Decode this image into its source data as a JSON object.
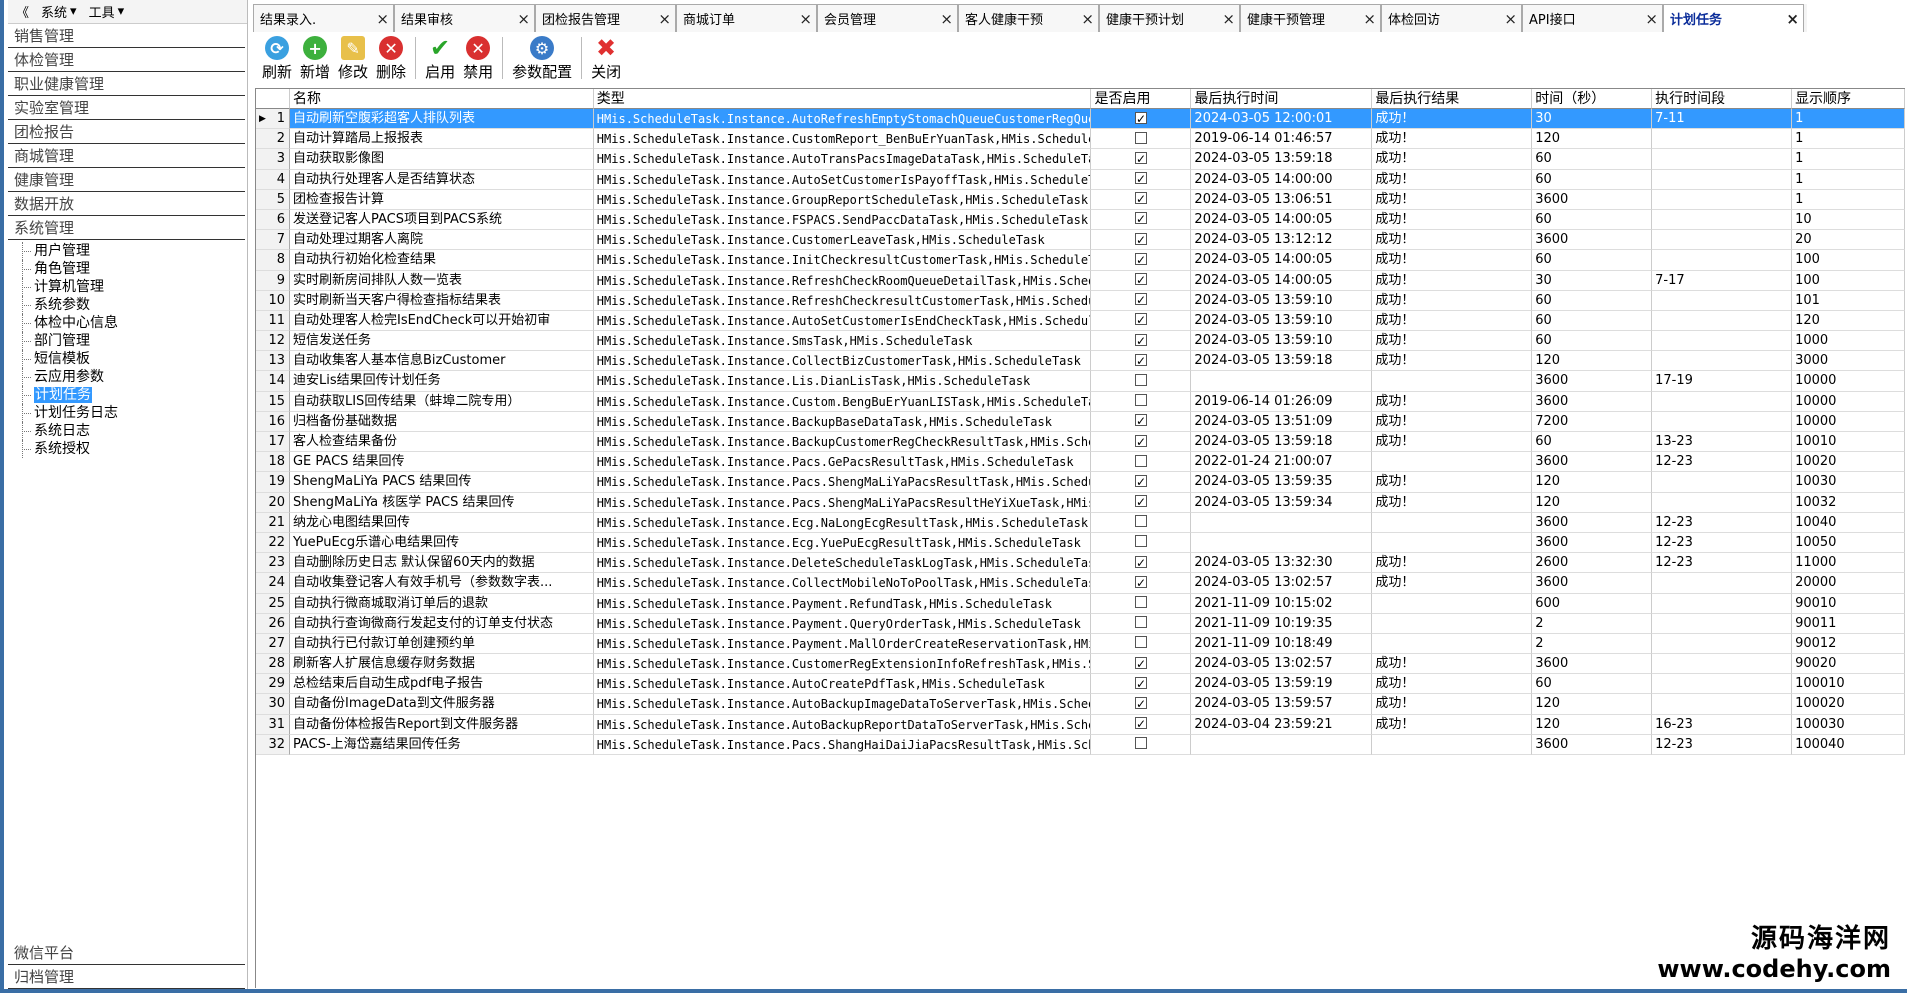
{
  "sidebar": {
    "collapse_glyph": "《",
    "menu_system": "系统",
    "menu_tools": "工具",
    "groups_top": [
      "销售管理",
      "体检管理",
      "职业健康管理",
      "实验室管理",
      "团检报告",
      "商城管理",
      "健康管理",
      "数据开放",
      "系统管理"
    ],
    "tree": [
      "用户管理",
      "角色管理",
      "计算机管理",
      "系统参数",
      "体检中心信息",
      "部门管理",
      "短信模板",
      "云应用参数",
      "计划任务",
      "计划任务日志",
      "系统日志",
      "系统授权"
    ],
    "selected_tree_index": 8,
    "groups_bottom": [
      "微信平台",
      "归档管理"
    ]
  },
  "tabs": [
    {
      "label": "结果录入."
    },
    {
      "label": "结果审核"
    },
    {
      "label": "团检报告管理"
    },
    {
      "label": "商城订单"
    },
    {
      "label": "会员管理"
    },
    {
      "label": "客人健康干预"
    },
    {
      "label": "健康干预计划"
    },
    {
      "label": "健康干预管理"
    },
    {
      "label": "体检回访"
    },
    {
      "label": "API接口"
    },
    {
      "label": "计划任务",
      "active": true
    }
  ],
  "toolbar": {
    "refresh": "刷新",
    "add": "新增",
    "edit": "修改",
    "delete": "删除",
    "enable": "启用",
    "disable": "禁用",
    "param_config": "参数配置",
    "close": "关闭"
  },
  "columns": {
    "name": "名称",
    "type": "类型",
    "enabled": "是否启用",
    "last_run": "最后执行时间",
    "last_result": "最后执行结果",
    "interval": "时间（秒）",
    "period": "执行时间段",
    "order": "显示顺序"
  },
  "rows": [
    {
      "i": "1",
      "name": "自动刷新空腹彩超客人排队列表",
      "type": "HMis.ScheduleTask.Instance.AutoRefreshEmptyStomachQueueCustomerRegQueu",
      "on": true,
      "last": "2024-03-05 12:00:01",
      "result": "成功！",
      "sec": "30",
      "period": "7-11",
      "order": "1"
    },
    {
      "i": "2",
      "name": "自动计算踏局上报报表",
      "type": "HMis.ScheduleTask.Instance.CustomReport_BenBuErYuanTask,HMis.ScheduleT",
      "on": false,
      "last": "2019-06-14 01:46:57",
      "result": "成功！",
      "sec": "120",
      "period": "",
      "order": "1"
    },
    {
      "i": "3",
      "name": "自动获取影像图",
      "type": "HMis.ScheduleTask.Instance.AutoTransPacsImageDataTask,HMis.ScheduleTas",
      "on": true,
      "last": "2024-03-05 13:59:18",
      "result": "成功！",
      "sec": "60",
      "period": "",
      "order": "1"
    },
    {
      "i": "4",
      "name": "自动执行处理客人是否结算状态",
      "type": "HMis.ScheduleTask.Instance.AutoSetCustomerIsPayoffTask,HMis.ScheduleTa",
      "on": true,
      "last": "2024-03-05 14:00:00",
      "result": "成功！",
      "sec": "60",
      "period": "",
      "order": "1"
    },
    {
      "i": "5",
      "name": "团检查报告计算",
      "type": "HMis.ScheduleTask.Instance.GroupReportScheduleTask,HMis.ScheduleTask",
      "on": true,
      "last": "2024-03-05 13:06:51",
      "result": "成功！",
      "sec": "3600",
      "period": "",
      "order": "1"
    },
    {
      "i": "6",
      "name": "发送登记客人PACS项目到PACS系统",
      "type": "HMis.ScheduleTask.Instance.FSPACS.SendPaccDataTask,HMis.ScheduleTask",
      "on": true,
      "last": "2024-03-05 14:00:05",
      "result": "成功！",
      "sec": "60",
      "period": "",
      "order": "10"
    },
    {
      "i": "7",
      "name": "自动处理过期客人离院",
      "type": "HMis.ScheduleTask.Instance.CustomerLeaveTask,HMis.ScheduleTask",
      "on": true,
      "last": "2024-03-05 13:12:12",
      "result": "成功！",
      "sec": "3600",
      "period": "",
      "order": "20"
    },
    {
      "i": "8",
      "name": "自动执行初始化检查结果",
      "type": "HMis.ScheduleTask.Instance.InitCheckresultCustomerTask,HMis.ScheduleTa",
      "on": true,
      "last": "2024-03-05 14:00:05",
      "result": "成功！",
      "sec": "60",
      "period": "",
      "order": "100"
    },
    {
      "i": "9",
      "name": "实时刷新房间排队人数一览表",
      "type": "HMis.ScheduleTask.Instance.RefreshCheckRoomQueueDetailTask,HMis.Schedu",
      "on": true,
      "last": "2024-03-05 14:00:05",
      "result": "成功！",
      "sec": "30",
      "period": "7-17",
      "order": "100"
    },
    {
      "i": "10",
      "name": "实时刷新当天客户得检查指标结果表",
      "type": "HMis.ScheduleTask.Instance.RefreshCheckresultCustomerTask,HMis.Schedul",
      "on": true,
      "last": "2024-03-05 13:59:10",
      "result": "成功！",
      "sec": "60",
      "period": "",
      "order": "101"
    },
    {
      "i": "11",
      "name": "自动处理客人检完IsEndCheck可以开始初审",
      "type": "HMis.ScheduleTask.Instance.AutoSetCustomerIsEndCheckTask,HMis.Schedule",
      "on": true,
      "last": "2024-03-05 13:59:10",
      "result": "成功！",
      "sec": "60",
      "period": "",
      "order": "120"
    },
    {
      "i": "12",
      "name": "短信发送任务",
      "type": "HMis.ScheduleTask.Instance.SmsTask,HMis.ScheduleTask",
      "on": true,
      "last": "2024-03-05 13:59:10",
      "result": "成功！",
      "sec": "60",
      "period": "",
      "order": "1000"
    },
    {
      "i": "13",
      "name": "自动收集客人基本信息BizCustomer",
      "type": "HMis.ScheduleTask.Instance.CollectBizCustomerTask,HMis.ScheduleTask",
      "on": true,
      "last": "2024-03-05 13:59:18",
      "result": "成功！",
      "sec": "120",
      "period": "",
      "order": "3000"
    },
    {
      "i": "14",
      "name": "迪安Lis结果回传计划任务",
      "type": "HMis.ScheduleTask.Instance.Lis.DianLisTask,HMis.ScheduleTask",
      "on": false,
      "last": "",
      "result": "",
      "sec": "3600",
      "period": "17-19",
      "order": "10000"
    },
    {
      "i": "15",
      "name": "自动获取LIS回传结果（蚌埠二院专用）",
      "type": "HMis.ScheduleTask.Instance.Custom.BengBuErYuanLISTask,HMis.ScheduleTas",
      "on": false,
      "last": "2019-06-14 01:26:09",
      "result": "成功！",
      "sec": "3600",
      "period": "",
      "order": "10000"
    },
    {
      "i": "16",
      "name": "归档备份基础数据",
      "type": "HMis.ScheduleTask.Instance.BackupBaseDataTask,HMis.ScheduleTask",
      "on": true,
      "last": "2024-03-05 13:51:09",
      "result": "成功！",
      "sec": "7200",
      "period": "",
      "order": "10000"
    },
    {
      "i": "17",
      "name": "客人检查结果备份",
      "type": "HMis.ScheduleTask.Instance.BackupCustomerRegCheckResultTask,HMis.Sched",
      "on": true,
      "last": "2024-03-05 13:59:18",
      "result": "成功！",
      "sec": "60",
      "period": "13-23",
      "order": "10010"
    },
    {
      "i": "18",
      "name": "GE PACS 结果回传",
      "type": "HMis.ScheduleTask.Instance.Pacs.GePacsResultTask,HMis.ScheduleTask",
      "on": false,
      "last": "2022-01-24 21:00:07",
      "result": "",
      "sec": "3600",
      "period": "12-23",
      "order": "10020"
    },
    {
      "i": "19",
      "name": "ShengMaLiYa PACS 结果回传",
      "type": "HMis.ScheduleTask.Instance.Pacs.ShengMaLiYaPacsResultTask,HMis.Schedul",
      "on": true,
      "last": "2024-03-05 13:59:35",
      "result": "成功！",
      "sec": "120",
      "period": "",
      "order": "10030"
    },
    {
      "i": "20",
      "name": "ShengMaLiYa 核医学 PACS 结果回传",
      "type": "HMis.ScheduleTask.Instance.Pacs.ShengMaLiYaPacsResultHeYiXueTask,HMis.",
      "on": true,
      "last": "2024-03-05 13:59:34",
      "result": "成功！",
      "sec": "120",
      "period": "",
      "order": "10032"
    },
    {
      "i": "21",
      "name": "纳龙心电图结果回传",
      "type": "HMis.ScheduleTask.Instance.Ecg.NaLongEcgResultTask,HMis.ScheduleTask",
      "on": false,
      "last": "",
      "result": "",
      "sec": "3600",
      "period": "12-23",
      "order": "10040"
    },
    {
      "i": "22",
      "name": "YuePuEcg乐谱心电结果回传",
      "type": "HMis.ScheduleTask.Instance.Ecg.YuePuEcgResultTask,HMis.ScheduleTask",
      "on": false,
      "last": "",
      "result": "",
      "sec": "3600",
      "period": "12-23",
      "order": "10050"
    },
    {
      "i": "23",
      "name": "自动删除历史日志 默认保留60天内的数据",
      "type": "HMis.ScheduleTask.Instance.DeleteScheduleTaskLogTask,HMis.ScheduleTask",
      "on": true,
      "last": "2024-03-05 13:32:30",
      "result": "成功！",
      "sec": "2600",
      "period": "12-23",
      "order": "11000"
    },
    {
      "i": "24",
      "name": "自动收集登记客人有效手机号（参数数字表...",
      "type": "HMis.ScheduleTask.Instance.CollectMobileNoToPoolTask,HMis.ScheduleTask",
      "on": true,
      "last": "2024-03-05 13:02:57",
      "result": "成功！",
      "sec": "3600",
      "period": "",
      "order": "20000"
    },
    {
      "i": "25",
      "name": "自动执行微商城取消订单后的退款",
      "type": "HMis.ScheduleTask.Instance.Payment.RefundTask,HMis.ScheduleTask",
      "on": false,
      "last": "2021-11-09 10:15:02",
      "result": "",
      "sec": "600",
      "period": "",
      "order": "90010"
    },
    {
      "i": "26",
      "name": "自动执行查询微商行发起支付的订单支付状态",
      "type": "HMis.ScheduleTask.Instance.Payment.QueryOrderTask,HMis.ScheduleTask",
      "on": false,
      "last": "2021-11-09 10:19:35",
      "result": "",
      "sec": "2",
      "period": "",
      "order": "90011"
    },
    {
      "i": "27",
      "name": "自动执行已付款订单创建预约单",
      "type": "HMis.ScheduleTask.Instance.Payment.MallOrderCreateReservationTask,HMis",
      "on": false,
      "last": "2021-11-09 10:18:49",
      "result": "",
      "sec": "2",
      "period": "",
      "order": "90012"
    },
    {
      "i": "28",
      "name": "刷新客人扩展信息缓存财务数据",
      "type": "HMis.ScheduleTask.Instance.CustomerRegExtensionInfoRefreshTask,HMis.Sc",
      "on": true,
      "last": "2024-03-05 13:02:57",
      "result": "成功！",
      "sec": "3600",
      "period": "",
      "order": "90020"
    },
    {
      "i": "29",
      "name": "总检结束后自动生成pdf电子报告",
      "type": "HMis.ScheduleTask.Instance.AutoCreatePdfTask,HMis.ScheduleTask",
      "on": true,
      "last": "2024-03-05 13:59:19",
      "result": "成功！",
      "sec": "60",
      "period": "",
      "order": "100010"
    },
    {
      "i": "30",
      "name": "自动备份ImageData到文件服务器",
      "type": "HMis.ScheduleTask.Instance.AutoBackupImageDataToServerTask,HMis.Schedu",
      "on": true,
      "last": "2024-03-05 13:59:57",
      "result": "成功！",
      "sec": "120",
      "period": "",
      "order": "100020"
    },
    {
      "i": "31",
      "name": "自动备份体检报告Report到文件服务器",
      "type": "HMis.ScheduleTask.Instance.AutoBackupReportDataToServerTask,HMis.Sched",
      "on": true,
      "last": "2024-03-04 23:59:21",
      "result": "成功！",
      "sec": "120",
      "period": "16-23",
      "order": "100030"
    },
    {
      "i": "32",
      "name": "PACS-上海岱嘉结果回传任务",
      "type": "HMis.ScheduleTask.Instance.Pacs.ShangHaiDaiJiaPacsResultTask,HMis.Sche",
      "on": false,
      "last": "",
      "result": "",
      "sec": "3600",
      "period": "12-23",
      "order": "100040"
    }
  ],
  "selected_row": 0,
  "watermark": {
    "line1": "源码海洋网",
    "line2": "www.codehy.com"
  }
}
